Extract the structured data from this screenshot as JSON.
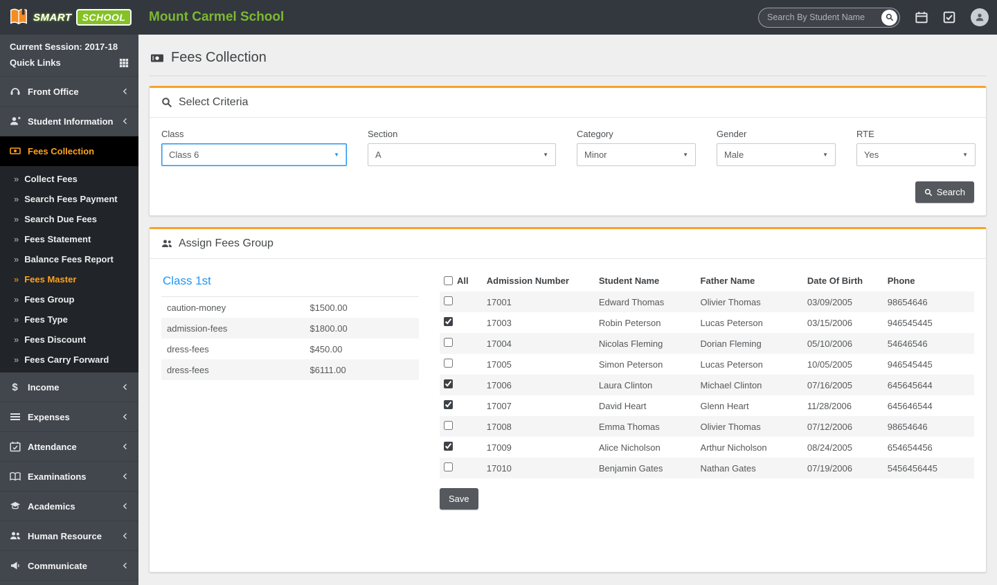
{
  "topbar": {
    "brand_smart": "SMART",
    "brand_school": "SCHOOL",
    "school_name": "Mount Carmel School",
    "search_placeholder": "Search By Student Name"
  },
  "sidebar": {
    "session": "Current Session: 2017-18",
    "quick_links": "Quick Links",
    "menu_top": [
      {
        "label": "Front Office"
      },
      {
        "label": "Student Information"
      }
    ],
    "fees_collection_label": "Fees Collection",
    "submenu": [
      {
        "label": "Collect Fees"
      },
      {
        "label": "Search Fees Payment"
      },
      {
        "label": "Search Due Fees"
      },
      {
        "label": "Fees Statement"
      },
      {
        "label": "Balance Fees Report"
      },
      {
        "label": "Fees Master"
      },
      {
        "label": "Fees Group"
      },
      {
        "label": "Fees Type"
      },
      {
        "label": "Fees Discount"
      },
      {
        "label": "Fees Carry Forward"
      }
    ],
    "menu_bottom": [
      {
        "label": "Income"
      },
      {
        "label": "Expenses"
      },
      {
        "label": "Attendance"
      },
      {
        "label": "Examinations"
      },
      {
        "label": "Academics"
      },
      {
        "label": "Human Resource"
      },
      {
        "label": "Communicate"
      }
    ]
  },
  "page": {
    "title": "Fees Collection"
  },
  "criteria": {
    "title": "Select Criteria",
    "fields": [
      {
        "label": "Class",
        "value": "Class 6"
      },
      {
        "label": "Section",
        "value": "A"
      },
      {
        "label": "Category",
        "value": "Minor"
      },
      {
        "label": "Gender",
        "value": "Male"
      },
      {
        "label": "RTE",
        "value": "Yes"
      }
    ],
    "search_button": "Search"
  },
  "assign": {
    "title": "Assign Fees Group",
    "class_heading": "Class 1st",
    "fees": [
      {
        "name": "caution-money",
        "amount": "$1500.00"
      },
      {
        "name": "admission-fees",
        "amount": "$1800.00"
      },
      {
        "name": "dress-fees",
        "amount": "$450.00"
      },
      {
        "name": "dress-fees",
        "amount": "$6111.00"
      }
    ],
    "all_label": "All",
    "columns": [
      "Admission Number",
      "Student Name",
      "Father Name",
      "Date Of Birth",
      "Phone"
    ],
    "rows": [
      {
        "checked": false,
        "admission_number": "17001",
        "student_name": "Edward Thomas",
        "father_name": "Olivier Thomas",
        "dob": "03/09/2005",
        "phone": "98654646"
      },
      {
        "checked": true,
        "admission_number": "17003",
        "student_name": "Robin Peterson",
        "father_name": "Lucas Peterson",
        "dob": "03/15/2006",
        "phone": "946545445"
      },
      {
        "checked": false,
        "admission_number": "17004",
        "student_name": "Nicolas Fleming",
        "father_name": "Dorian Fleming",
        "dob": "05/10/2006",
        "phone": "54646546"
      },
      {
        "checked": false,
        "admission_number": "17005",
        "student_name": "Simon Peterson",
        "father_name": "Lucas Peterson",
        "dob": "10/05/2005",
        "phone": "946545445"
      },
      {
        "checked": true,
        "admission_number": "17006",
        "student_name": "Laura Clinton",
        "father_name": "Michael Clinton",
        "dob": "07/16/2005",
        "phone": "645645644"
      },
      {
        "checked": true,
        "admission_number": "17007",
        "student_name": "David Heart",
        "father_name": "Glenn Heart",
        "dob": "11/28/2006",
        "phone": "645646544"
      },
      {
        "checked": false,
        "admission_number": "17008",
        "student_name": "Emma Thomas",
        "father_name": "Olivier Thomas",
        "dob": "07/12/2006",
        "phone": "98654646"
      },
      {
        "checked": true,
        "admission_number": "17009",
        "student_name": "Alice Nicholson",
        "father_name": "Arthur Nicholson",
        "dob": "08/24/2005",
        "phone": "654654456"
      },
      {
        "checked": false,
        "admission_number": "17010",
        "student_name": "Benjamin Gates",
        "father_name": "Nathan Gates",
        "dob": "07/19/2006",
        "phone": "5456456445"
      }
    ],
    "save_button": "Save"
  },
  "colors": {
    "accent_orange": "#f7a32b",
    "active_orange": "#ffa21d",
    "brand_green": "#84c225",
    "link_blue": "#2196f3",
    "topbar_bg": "#33383e",
    "sidebar_bg": "#42474d"
  }
}
